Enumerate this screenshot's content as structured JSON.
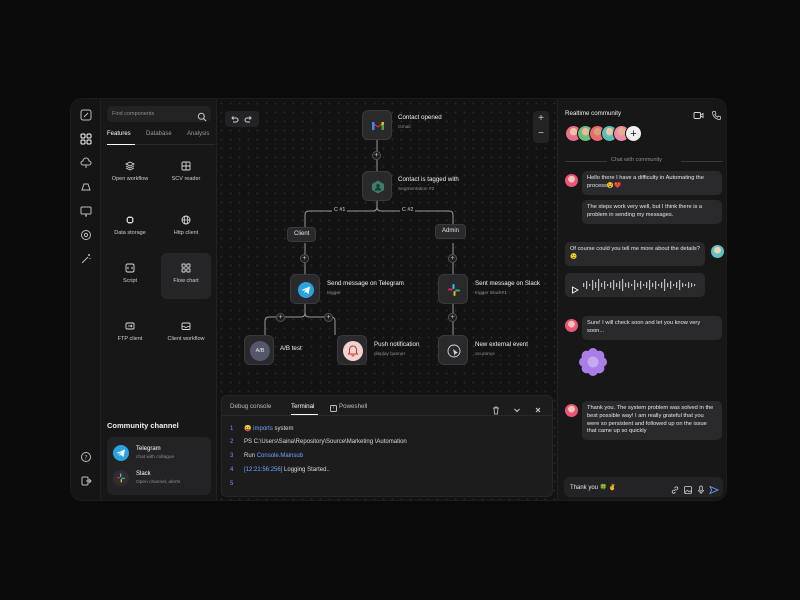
{
  "sidebar": {
    "search_placeholder": "Find components",
    "tabs": [
      "Features",
      "Database",
      "Analysis"
    ],
    "features": [
      {
        "label": "Open workflow",
        "icon": "layers-icon"
      },
      {
        "label": "SCV reader",
        "icon": "grid-table-icon"
      },
      {
        "label": "Data storage",
        "icon": "chip-icon"
      },
      {
        "label": "Http client",
        "icon": "globe-icon"
      },
      {
        "label": "Script",
        "icon": "code-icon"
      },
      {
        "label": "Flow chart",
        "icon": "apps-icon"
      },
      {
        "label": "FTP client",
        "icon": "ftp-icon"
      },
      {
        "label": "Client workflow",
        "icon": "inbox-icon"
      }
    ],
    "community_title": "Community channel",
    "channels": [
      {
        "name": "Telegram",
        "desc": "chat with collague"
      },
      {
        "name": "Slack",
        "desc": "Open channel, alerts"
      }
    ]
  },
  "flow": {
    "nodes": {
      "gmail": {
        "title": "Contact opened",
        "sub": "Gmail"
      },
      "segment": {
        "title": "Contact is tagged with",
        "sub": "Segmentation #2"
      },
      "telegram": {
        "title": "Send message on Telegram",
        "sub": "trigger"
      },
      "slack": {
        "title": "Sent message on Slack",
        "sub": "trigger Slack#1"
      },
      "ab": {
        "title": "A/B test",
        "badge": "A/B"
      },
      "push": {
        "title": "Push notification",
        "sub": "display banner"
      },
      "external": {
        "title": "New external event",
        "sub": "ocurance"
      }
    },
    "branch_labels": [
      "C #1",
      "C #2"
    ],
    "pills": [
      "Client",
      "Admin"
    ]
  },
  "console": {
    "tabs": [
      "Debug console",
      "Terminal",
      "Poweshell"
    ],
    "lines": [
      {
        "num": "1",
        "emoji": "😛",
        "pre": "",
        "blue": "imports",
        "post": " system"
      },
      {
        "num": "2",
        "emoji": "",
        "pre": "PS C:\\Users\\Saina\\Repository\\Source\\Marketing \\Automation",
        "blue": "",
        "post": ""
      },
      {
        "num": "3",
        "emoji": "",
        "pre": "Run ",
        "blue": "Console.Mainsub",
        "post": ""
      },
      {
        "num": "4",
        "emoji": "",
        "pre": "",
        "blue": "[12:21:56:256]",
        "post": "  Logging Started.."
      },
      {
        "num": "5",
        "emoji": "",
        "pre": "",
        "blue": "",
        "post": ""
      }
    ]
  },
  "chat": {
    "title": "Realtime community",
    "divider": "Chat with community",
    "messages": [
      "Hello there I have a difficulty in Automating the process😵❤️",
      "The steps work very well, but I think there is a problem in sending my messages.",
      "Of course could you tell me more about the details? 😉",
      "Sure! I will check soon and let you know very soon...",
      "Thank you. The system problem was solved in the best possible way! I am really grateful that you were so persistent and followed up on the issue that came up so quickly"
    ],
    "composer_value": "Thank you 🍀 ✌️"
  },
  "colors": {
    "telegram": "#2aa3e0",
    "slack_red": "#e01e5a",
    "sticker": "#a97ee6",
    "accent_blue": "#6ea8ff"
  }
}
